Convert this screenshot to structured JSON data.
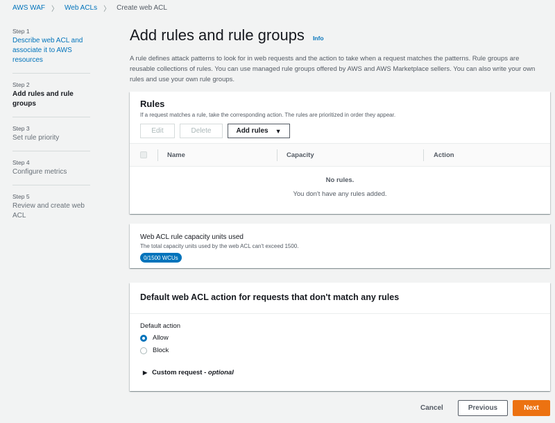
{
  "breadcrumb": {
    "items": [
      {
        "label": "AWS WAF"
      },
      {
        "label": "Web ACLs"
      },
      {
        "label": "Create web ACL"
      }
    ],
    "separator": "〉"
  },
  "wizard": {
    "steps": [
      {
        "number": "Step 1",
        "label": "Describe web ACL and associate it to AWS resources",
        "state": "link"
      },
      {
        "number": "Step 2",
        "label": "Add rules and rule groups",
        "state": "active"
      },
      {
        "number": "Step 3",
        "label": "Set rule priority",
        "state": "disabled"
      },
      {
        "number": "Step 4",
        "label": "Configure metrics",
        "state": "disabled"
      },
      {
        "number": "Step 5",
        "label": "Review and create web ACL",
        "state": "disabled"
      }
    ]
  },
  "page": {
    "title": "Add rules and rule groups",
    "info": "Info",
    "intro": "A rule defines attack patterns to look for in web requests and the action to take when a request matches the patterns. Rule groups are reusable collections of rules. You can use managed rule groups offered by AWS and AWS Marketplace sellers. You can also write your own rules and use your own rule groups."
  },
  "rules": {
    "title": "Rules",
    "description": "If a request matches a rule, take the corresponding action. The rules are prioritized in order they appear.",
    "edit_label": "Edit",
    "delete_label": "Delete",
    "add_label": "Add rules",
    "columns": [
      "Name",
      "Capacity",
      "Action"
    ],
    "empty_title": "No rules.",
    "empty_text": "You don't have any rules added."
  },
  "capacity": {
    "title": "Web ACL rule capacity units used",
    "description": "The total capacity units used by the web ACL can't exceed 1500.",
    "badge": "0/1500 WCUs"
  },
  "default_action": {
    "title": "Default web ACL action for requests that don't match any rules",
    "field_label": "Default action",
    "options": [
      {
        "label": "Allow",
        "selected": true
      },
      {
        "label": "Block",
        "selected": false
      }
    ],
    "custom_request_label": "Custom request - ",
    "custom_request_optional": "optional"
  },
  "footer": {
    "cancel_label": "Cancel",
    "previous_label": "Previous",
    "next_label": "Next"
  },
  "colors": {
    "link": "#0073bb",
    "primary": "#ec7211",
    "background": "#f2f3f3"
  }
}
